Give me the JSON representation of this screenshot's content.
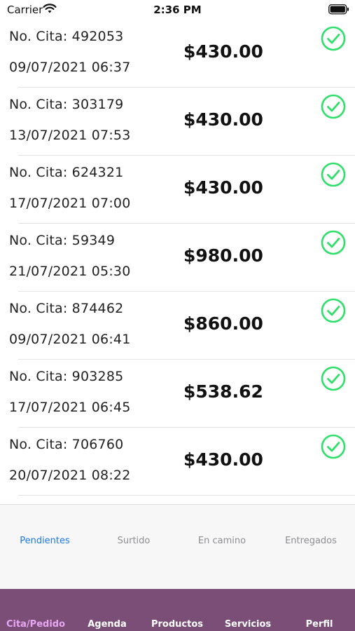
{
  "status_bar": {
    "carrier": "Carrier",
    "time": "2:36 PM",
    "wifi_icon": "wifi-icon",
    "battery_icon": "battery-icon"
  },
  "orders": [
    {
      "cita": "No. Cita: 492053",
      "date": "09/07/2021 06:37",
      "amount": "$430.00",
      "status_icon": "check-circle-icon"
    },
    {
      "cita": "No. Cita: 303179",
      "date": "13/07/2021 07:53",
      "amount": "$430.00",
      "status_icon": "check-circle-icon"
    },
    {
      "cita": "No. Cita: 624321",
      "date": "17/07/2021 07:00",
      "amount": "$430.00",
      "status_icon": "check-circle-icon"
    },
    {
      "cita": "No. Cita: 59349",
      "date": "21/07/2021 05:30",
      "amount": "$980.00",
      "status_icon": "check-circle-icon"
    },
    {
      "cita": "No. Cita: 874462",
      "date": "09/07/2021 06:41",
      "amount": "$860.00",
      "status_icon": "check-circle-icon"
    },
    {
      "cita": "No. Cita: 903285",
      "date": "17/07/2021 06:45",
      "amount": "$538.62",
      "status_icon": "check-circle-icon"
    },
    {
      "cita": "No. Cita: 706760",
      "date": "20/07/2021 08:22",
      "amount": "$430.00",
      "status_icon": "check-circle-icon"
    }
  ],
  "segment_tabs": [
    {
      "label": "Pendientes",
      "active": true
    },
    {
      "label": "Surtido",
      "active": false
    },
    {
      "label": "En camino",
      "active": false
    },
    {
      "label": "Entregados",
      "active": false
    }
  ],
  "tab_bar": [
    {
      "label": "Cita/Pedido",
      "active": true
    },
    {
      "label": "Agenda",
      "active": false
    },
    {
      "label": "Productos",
      "active": false
    },
    {
      "label": "Servicios",
      "active": false
    },
    {
      "label": "Perfil",
      "active": false
    }
  ],
  "colors": {
    "check_green": "#2ee06a",
    "segment_active": "#1f7ae8",
    "tabbar_bg": "#7b4e77",
    "tab_active": "#e7a6f2"
  }
}
